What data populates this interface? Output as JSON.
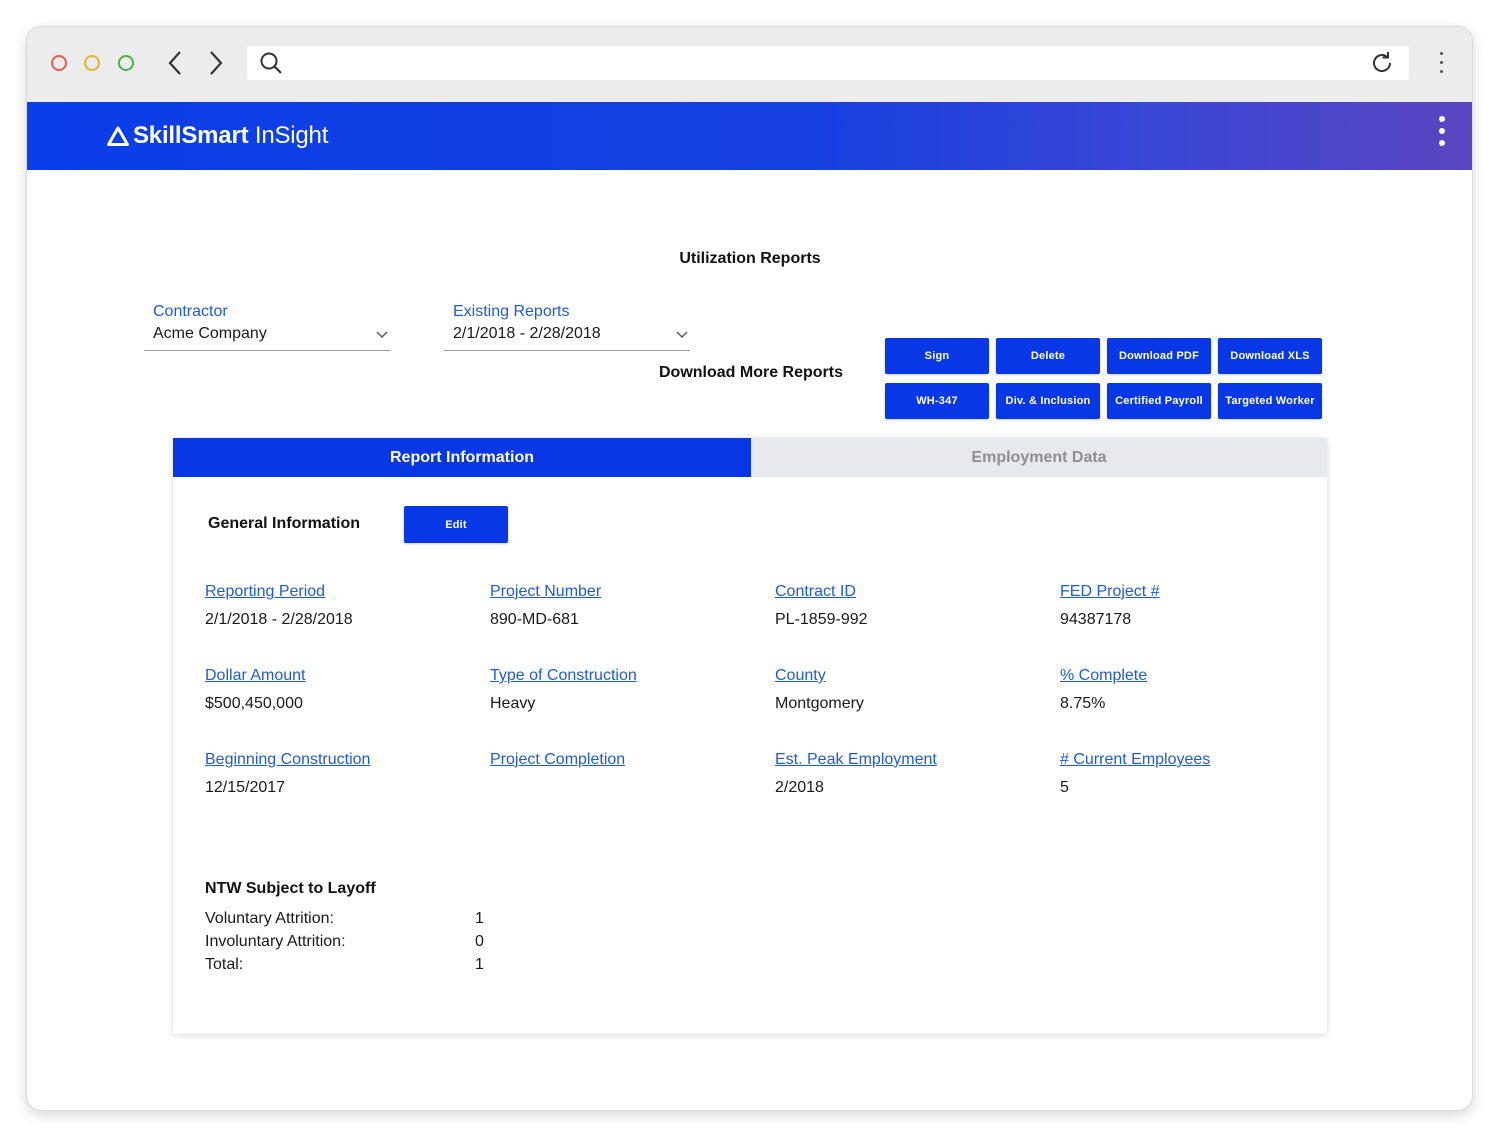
{
  "browser": {
    "url": ""
  },
  "app": {
    "brand_bold": "SkillSmart",
    "brand_light": " InSight"
  },
  "page": {
    "title": "Utilization Reports"
  },
  "contractor": {
    "label": "Contractor",
    "value": "Acme Company"
  },
  "existing_reports": {
    "label": "Existing Reports",
    "value": "2/1/2018 - 2/28/2018"
  },
  "actions": {
    "sign": "Sign",
    "delete": "Delete",
    "download_pdf": "Download PDF",
    "download_xls": "Download XLS"
  },
  "more_reports": {
    "label": "Download More Reports",
    "wh347": "WH-347",
    "div_inclusion": "Div. & Inclusion",
    "certified_payroll": "Certified Payroll",
    "targeted_worker": "Targeted Worker"
  },
  "tabs": {
    "report_info": "Report Information",
    "employment_data": "Employment Data"
  },
  "general": {
    "title": "General Information",
    "edit": "Edit",
    "fields": [
      {
        "label": "Reporting Period",
        "value": "2/1/2018 - 2/28/2018"
      },
      {
        "label": "Project Number",
        "value": "890-MD-681"
      },
      {
        "label": "Contract ID",
        "value": "PL-1859-992"
      },
      {
        "label": "FED Project #",
        "value": "94387178"
      },
      {
        "label": "Dollar Amount",
        "value": "$500,450,000"
      },
      {
        "label": "Type of Construction",
        "value": "Heavy"
      },
      {
        "label": "County",
        "value": "Montgomery"
      },
      {
        "label": "% Complete",
        "value": "8.75%"
      },
      {
        "label": "Beginning Construction",
        "value": "12/15/2017"
      },
      {
        "label": "Project Completion",
        "value": ""
      },
      {
        "label": "Est. Peak Employment",
        "value": "2/2018"
      },
      {
        "label": "# Current Employees",
        "value": "5"
      }
    ]
  },
  "ntw": {
    "title": "NTW Subject to Layoff",
    "rows": [
      {
        "label": "Voluntary Attrition:",
        "value": "1"
      },
      {
        "label": "Involuntary Attrition:",
        "value": "0"
      },
      {
        "label": "Total:",
        "value": "1"
      }
    ]
  },
  "colors": {
    "primary": "#0838e6",
    "link": "#1f5bd8",
    "tab_inactive_bg": "#e8e9ee"
  }
}
